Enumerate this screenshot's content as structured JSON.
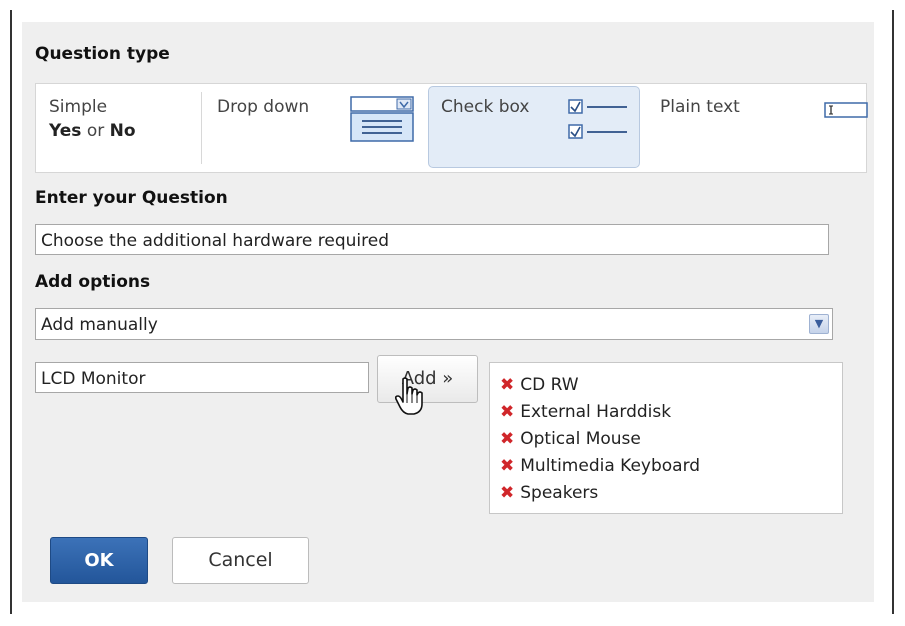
{
  "dialog": {
    "question_type_heading": "Question type",
    "enter_question_heading": "Enter your Question",
    "add_options_heading": "Add options"
  },
  "question_types": {
    "simple_label": "Simple",
    "simple_yes": "Yes",
    "simple_or": "or",
    "simple_no": "No",
    "dropdown_label": "Drop down",
    "checkbox_label": "Check box",
    "plaintext_label": "Plain text",
    "selected": "Check box"
  },
  "question_input": {
    "value": "Choose the additional hardware required"
  },
  "options_source": {
    "selected": "Add manually"
  },
  "option_entry": {
    "value": "LCD Monitor"
  },
  "add_button": {
    "label": "Add »"
  },
  "options_list": [
    {
      "label": "CD RW"
    },
    {
      "label": "External Harddisk"
    },
    {
      "label": "Optical Mouse"
    },
    {
      "label": "Multimedia Keyboard"
    },
    {
      "label": "Speakers"
    }
  ],
  "buttons": {
    "ok_label": "OK",
    "cancel_label": "Cancel"
  },
  "colors": {
    "primary_button": "#2c5fa3",
    "remove_icon": "#d0262a",
    "selected_option_bg": "#e3ecf7"
  },
  "icons": {
    "remove": "remove-x-icon",
    "dropdown_preview": "dropdown-preview-icon",
    "checkbox_preview": "checkbox-preview-icon",
    "textbox_preview": "textbox-preview-icon",
    "cursor": "hand-cursor-icon"
  }
}
